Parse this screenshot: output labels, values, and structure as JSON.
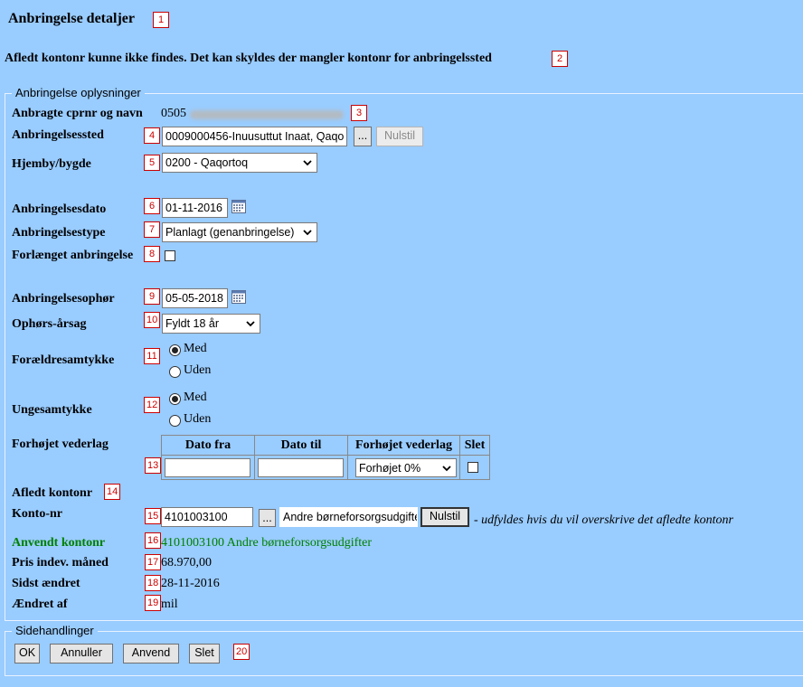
{
  "page": {
    "title": "Anbringelse detaljer",
    "warning": "Afledt kontonr kunne ikke findes. Det kan skyldes der mangler kontonr for anbringelssted"
  },
  "badges": [
    "1",
    "2",
    "3",
    "4",
    "5",
    "6",
    "7",
    "8",
    "9",
    "10",
    "11",
    "12",
    "13",
    "14",
    "15",
    "16",
    "17",
    "18",
    "19",
    "20"
  ],
  "section": {
    "legend": "Anbringelse oplysninger",
    "cpr_label": "Anbragte cprnr og navn",
    "cpr_value": "0505",
    "sted_label": "Anbringelsessted",
    "sted_value": "0009000456-Inuusuttut Inaat, Qaqo",
    "browse_label": "...",
    "reset_label": "Nulstil",
    "hjemby_label": "Hjemby/bygde",
    "hjemby_value": "0200 - Qaqortoq",
    "dato_label": "Anbringelsesdato",
    "dato_value": "01-11-2016",
    "type_label": "Anbringelsestype",
    "type_value": "Planlagt (genanbringelse)",
    "forlaenget_label": "Forlænget anbringelse",
    "ophoer_label": "Anbringelsesophør",
    "ophoer_value": "05-05-2018",
    "aarsag_label": "Ophørs-årsag",
    "aarsag_value": "Fyldt 18 år",
    "foraeldre_label": "Forældresamtykke",
    "unge_label": "Ungesamtykke",
    "radio_med": "Med",
    "radio_uden": "Uden",
    "vederlag_label": "Forhøjet vederlag",
    "table": {
      "headers": [
        "Dato fra",
        "Dato til",
        "Forhøjet vederlag",
        "Slet"
      ],
      "select_value": "Forhøjet 0%"
    },
    "afledt_label": "Afledt kontonr",
    "konto_label": "Konto-nr",
    "konto_value": "4101003100",
    "konto_text": "Andre børneforsorgsudgifter",
    "konto_hint": "- udfyldes hvis du vil overskrive det afledte kontonr",
    "anvendt_label": "Anvendt kontonr",
    "anvendt_value": "4101003100 Andre børneforsorgsudgifter",
    "pris_label": "Pris indev. måned",
    "pris_value": "68.970,00",
    "sidst_label": "Sidst ændret",
    "sidst_value": "28-11-2016",
    "aendret_label": "Ændret af",
    "aendret_value": "mil"
  },
  "side": {
    "legend": "Sidehandlinger",
    "ok": "OK",
    "annuller": "Annuller",
    "anvend": "Anvend",
    "slet": "Slet"
  },
  "colors": {
    "background": "#99ccff",
    "badge": "#cc0000",
    "green_text": "#008000"
  }
}
